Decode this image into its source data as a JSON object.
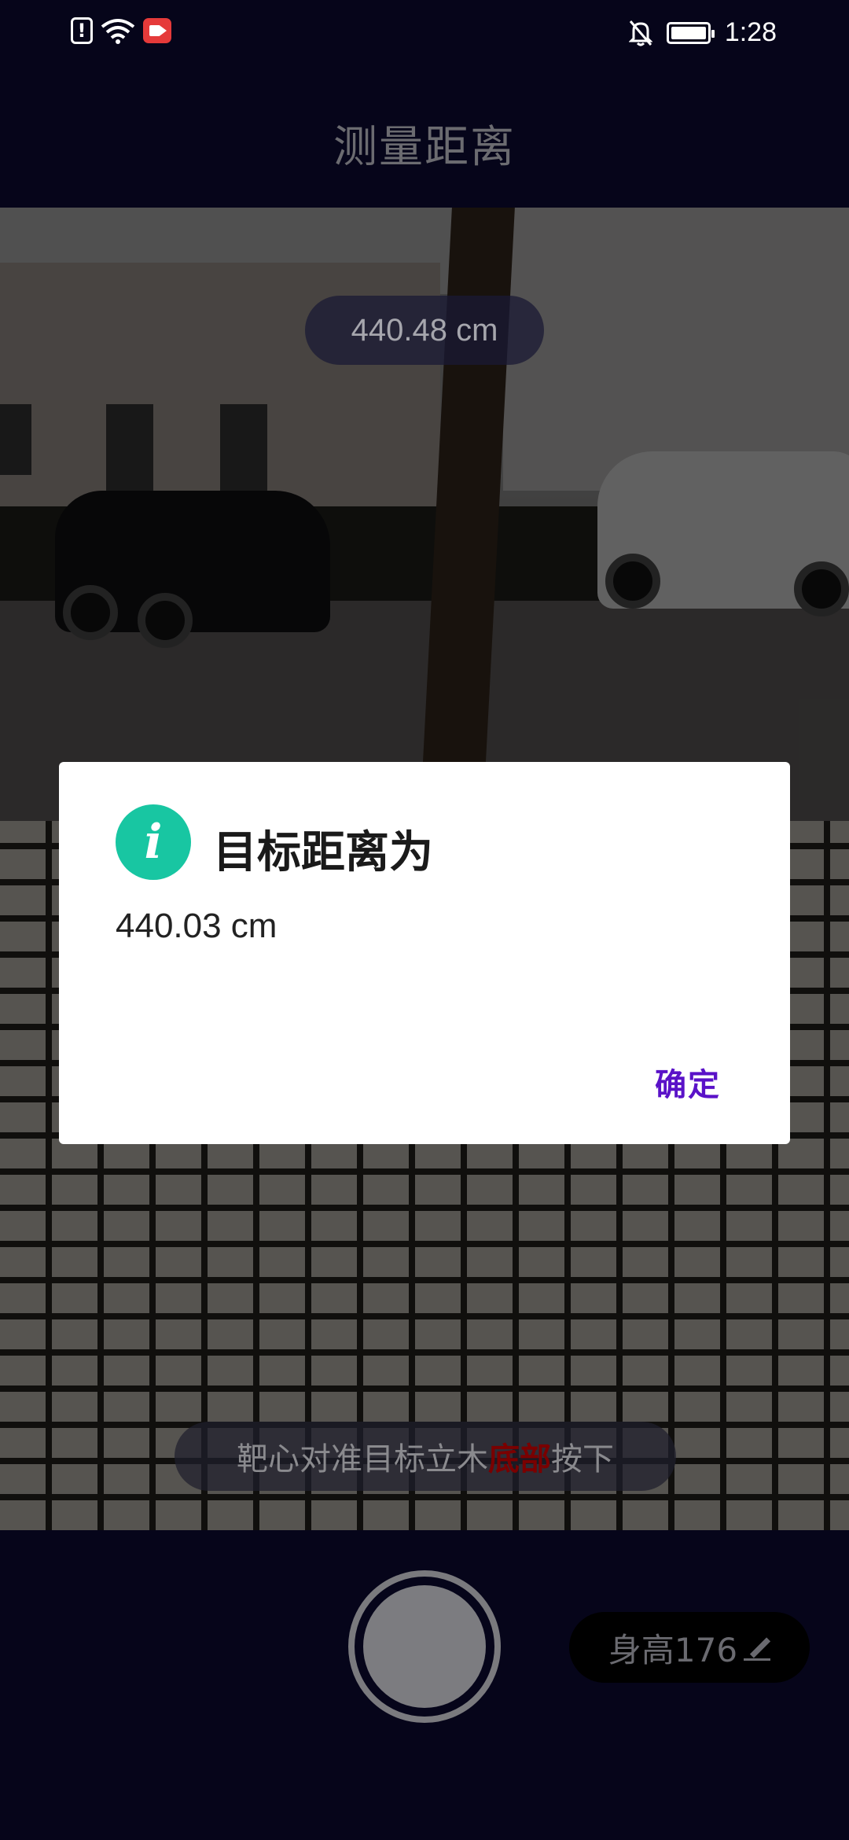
{
  "status_bar": {
    "time": "1:28",
    "left_icons": [
      "alert-icon",
      "wifi-icon",
      "screen-record-icon"
    ],
    "right_icons": [
      "bell-off-icon",
      "battery-icon"
    ]
  },
  "header": {
    "title": "测量距离"
  },
  "camera": {
    "live_reading": "440.48 cm",
    "hint_prefix": "靶心对准目标立木",
    "hint_emphasis": "底部",
    "hint_suffix": "按下"
  },
  "controls": {
    "height_label": "身高176",
    "height_edit_icon": "pencil-icon",
    "shutter_icon": "shutter-button"
  },
  "dialog": {
    "icon": "info-icon",
    "icon_glyph": "i",
    "title": "目标距离为",
    "message": "440.03 cm",
    "confirm_label": "确定"
  },
  "colors": {
    "background": "#06051a",
    "accent": "#5a12c8",
    "info_icon": "#18c6a2",
    "hint_emphasis": "#7a0000"
  }
}
